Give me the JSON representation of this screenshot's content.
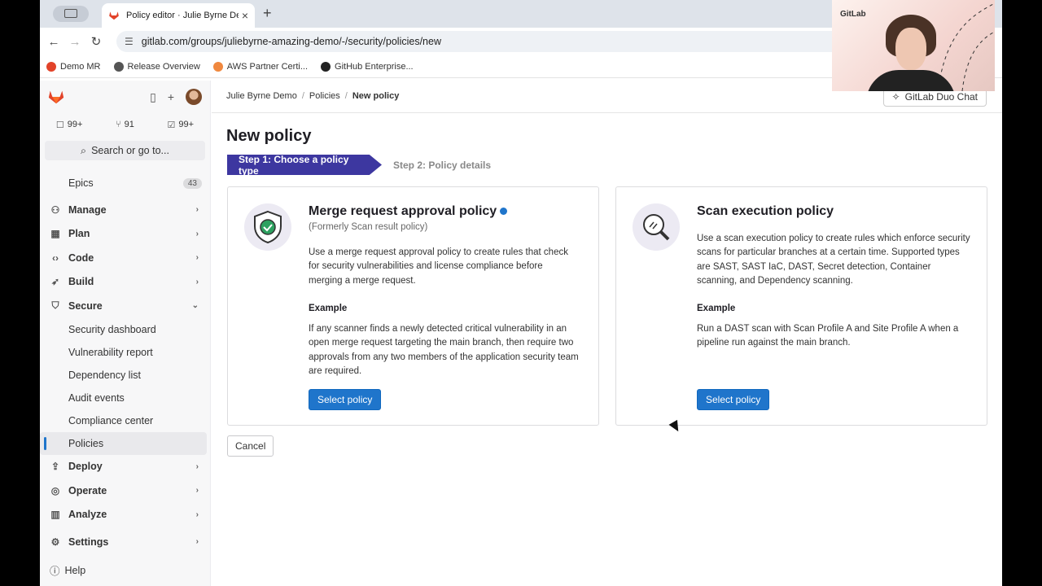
{
  "browser": {
    "tab_title": "Policy editor · Julie Byrne Demo",
    "url": "gitlab.com/groups/juliebyrne-amazing-demo/-/security/policies/new",
    "bookmarks": [
      {
        "label": "Demo MR",
        "icon": "gitlab-icon",
        "color": "#e24329"
      },
      {
        "label": "Release Overview",
        "icon": "globe-icon",
        "color": "#555555"
      },
      {
        "label": "AWS Partner Certi...",
        "icon": "aws-icon",
        "color": "#f0883e"
      },
      {
        "label": "GitHub Enterprise...",
        "icon": "github-icon",
        "color": "#222222"
      }
    ]
  },
  "sidebar": {
    "counts": [
      {
        "icon": "issues-icon",
        "value": "99+"
      },
      {
        "icon": "merge-request-icon",
        "value": "91"
      },
      {
        "icon": "todo-icon",
        "value": "99+"
      }
    ],
    "search_label": "Search or go to...",
    "epics": {
      "label": "Epics",
      "badge": "43"
    },
    "groups": [
      {
        "label": "Manage",
        "icon": "users-icon"
      },
      {
        "label": "Plan",
        "icon": "calendar-icon"
      },
      {
        "label": "Code",
        "icon": "code-icon"
      },
      {
        "label": "Build",
        "icon": "rocket-icon"
      },
      {
        "label": "Secure",
        "icon": "shield-icon"
      }
    ],
    "secure_items": [
      "Security dashboard",
      "Vulnerability report",
      "Dependency list",
      "Audit events",
      "Compliance center",
      "Policies"
    ],
    "groups_after": [
      {
        "label": "Deploy",
        "icon": "deploy-icon"
      },
      {
        "label": "Operate",
        "icon": "operate-icon"
      },
      {
        "label": "Analyze",
        "icon": "chart-icon"
      }
    ],
    "settings": "Settings",
    "help": "Help"
  },
  "breadcrumb": [
    "Julie Byrne Demo",
    "Policies",
    "New policy"
  ],
  "duo_chat": "GitLab Duo Chat",
  "page_title": "New policy",
  "steps": {
    "step1": "Step 1: Choose a policy type",
    "step2": "Step 2: Policy details"
  },
  "cards": [
    {
      "title": "Merge request approval policy",
      "subtitle": "(Formerly Scan result policy)",
      "description": "Use a merge request approval policy to create rules that check for security vulnerabilities and license compliance before merging a merge request.",
      "example_heading": "Example",
      "example": "If any scanner finds a newly detected critical vulnerability in an open merge request targeting the main branch, then require two approvals from any two members of the application security team are required.",
      "button": "Select policy"
    },
    {
      "title": "Scan execution policy",
      "subtitle": "",
      "description": "Use a scan execution policy to create rules which enforce security scans for particular branches at a certain time. Supported types are SAST, SAST IaC, DAST, Secret detection, Container scanning, and Dependency scanning.",
      "example_heading": "Example",
      "example": "Run a DAST scan with Scan Profile A and Site Profile A when a pipeline run against the main branch.",
      "button": "Select policy"
    }
  ],
  "cancel": "Cancel",
  "webcam_logo": "GitLab",
  "colors": {
    "primary": "#1f75cb",
    "step_active": "#3d37a0",
    "gitlab_orange": "#e24329"
  }
}
